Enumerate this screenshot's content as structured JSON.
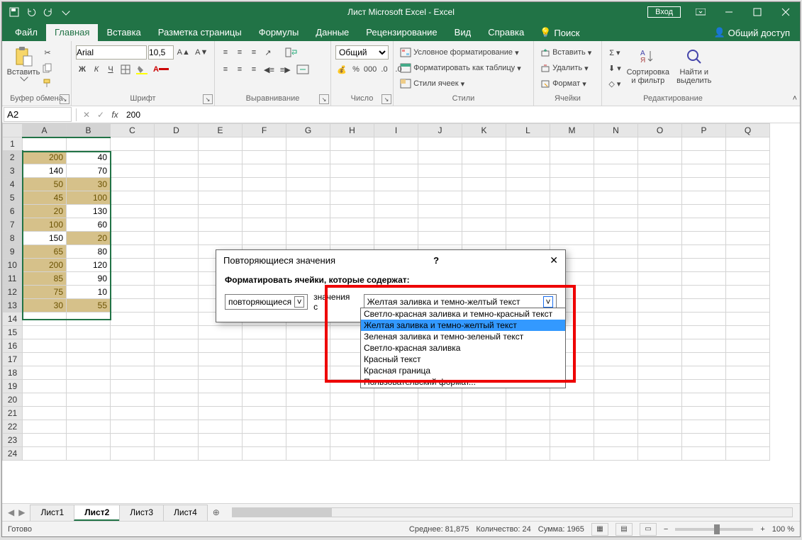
{
  "titlebar": {
    "title": "Лист Microsoft Excel  -  Excel",
    "login": "Вход"
  },
  "tabs": [
    "Файл",
    "Главная",
    "Вставка",
    "Разметка страницы",
    "Формулы",
    "Данные",
    "Рецензирование",
    "Вид",
    "Справка"
  ],
  "tell": "Поиск",
  "share": "Общий доступ",
  "ribbon": {
    "clipboard": {
      "paste": "Вставить",
      "label": "Буфер обмена"
    },
    "font": {
      "name": "Arial",
      "size": "10,5",
      "label": "Шрифт",
      "bold": "Ж",
      "italic": "К",
      "underline": "Ч"
    },
    "alignment": {
      "label": "Выравнивание"
    },
    "number": {
      "format": "Общий",
      "label": "Число"
    },
    "styles": {
      "cond": "Условное форматирование",
      "table": "Форматировать как таблицу",
      "cell": "Стили ячеек",
      "label": "Стили"
    },
    "cells": {
      "insert": "Вставить",
      "delete": "Удалить",
      "format": "Формат",
      "label": "Ячейки"
    },
    "editing": {
      "sort": "Сортировка\nи фильтр",
      "find": "Найти и\nвыделить",
      "label": "Редактирование"
    }
  },
  "namebox": "A2",
  "formula": "200",
  "cols": [
    "A",
    "B",
    "C",
    "D",
    "E",
    "F",
    "G",
    "H",
    "I",
    "J",
    "K",
    "L",
    "M",
    "N",
    "O",
    "P",
    "Q"
  ],
  "rows": 24,
  "chart_data": {
    "type": "table",
    "columns": [
      "A",
      "B"
    ],
    "data": [
      [
        200,
        40
      ],
      [
        140,
        70
      ],
      [
        50,
        30
      ],
      [
        45,
        100
      ],
      [
        20,
        130
      ],
      [
        100,
        60
      ],
      [
        150,
        20
      ],
      [
        65,
        80
      ],
      [
        200,
        120
      ],
      [
        85,
        90
      ],
      [
        75,
        10
      ],
      [
        30,
        55
      ]
    ],
    "highlight_A": [
      true,
      false,
      true,
      true,
      true,
      true,
      false,
      true,
      true,
      true,
      true,
      true
    ],
    "highlight_B": [
      false,
      false,
      true,
      true,
      false,
      false,
      true,
      false,
      false,
      false,
      false,
      true
    ]
  },
  "sheets": [
    "Лист1",
    "Лист2",
    "Лист3",
    "Лист4"
  ],
  "active_sheet": 1,
  "status": {
    "ready": "Готово",
    "avg": "Среднее: 81,875",
    "count": "Количество: 24",
    "sum": "Сумма: 1965",
    "zoom": "100 %"
  },
  "dialog": {
    "title": "Повторяющиеся значения",
    "prompt": "Форматировать ячейки, которые содержат:",
    "left_sel": "повторяющиеся",
    "mid": "значения с",
    "combo": "Желтая заливка и темно-желтый текст",
    "options": [
      "Светло-красная заливка и темно-красный текст",
      "Желтая заливка и темно-желтый текст",
      "Зеленая заливка и темно-зеленый текст",
      "Светло-красная заливка",
      "Красный текст",
      "Красная граница",
      "Пользовательский формат..."
    ],
    "highlight_option": 1
  }
}
